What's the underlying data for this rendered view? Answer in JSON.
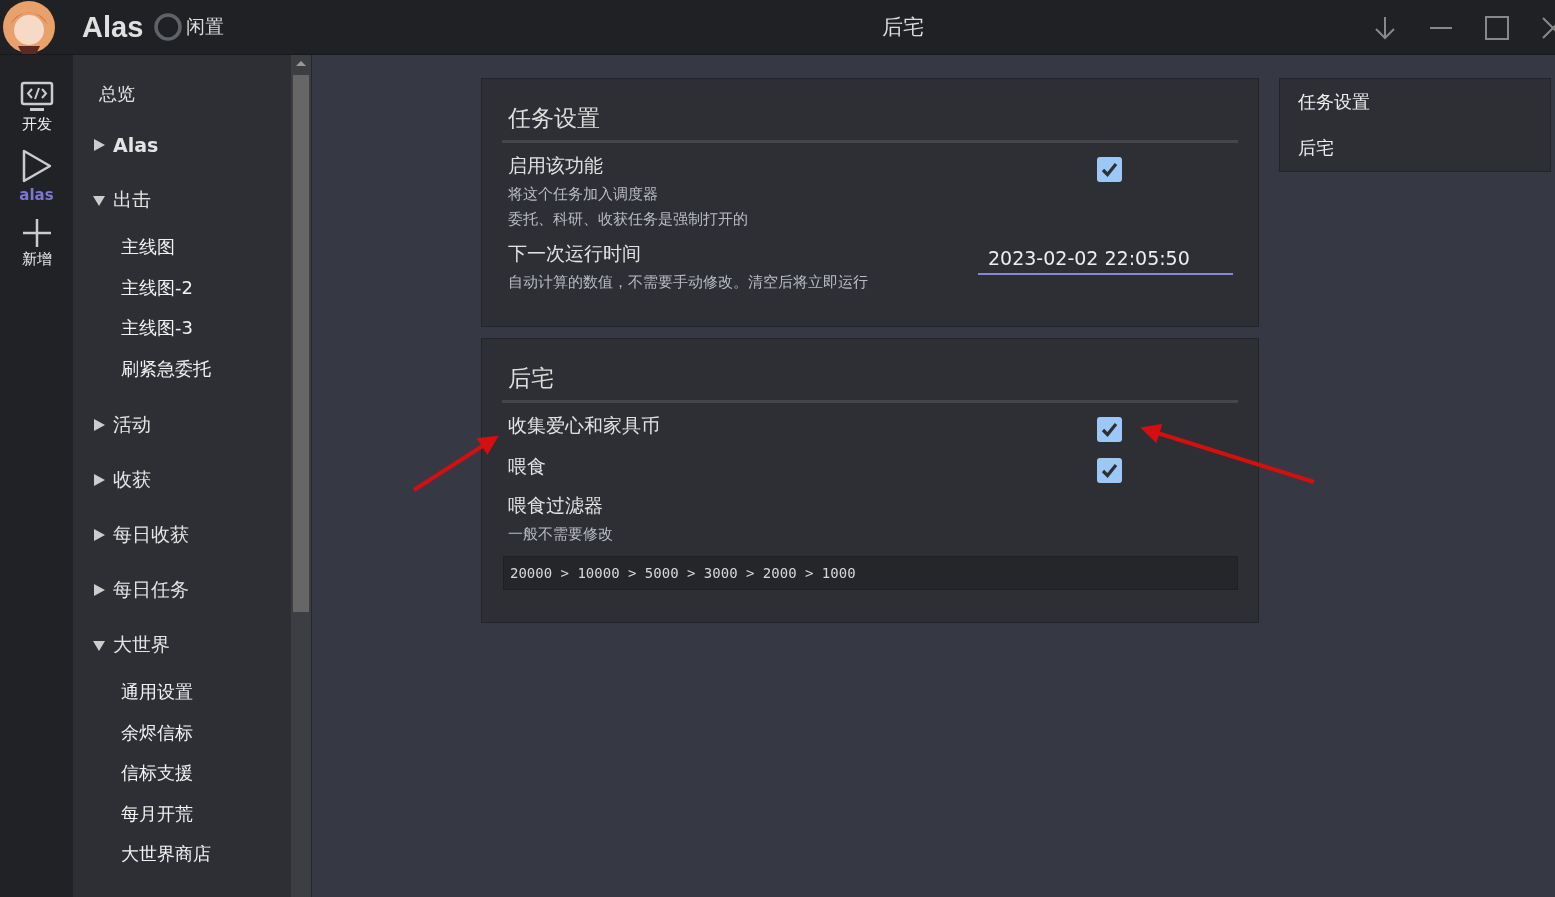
{
  "header": {
    "app_name": "Alas",
    "status": "闲置",
    "page_title": "后宅"
  },
  "rail": [
    {
      "kind": "code",
      "label": "开发",
      "selected": false
    },
    {
      "kind": "play",
      "label": "alas",
      "selected": true
    },
    {
      "kind": "add",
      "label": "新增",
      "selected": false
    }
  ],
  "nav": [
    {
      "kind": "item",
      "label": "总览"
    },
    {
      "kind": "group",
      "label": "Alas",
      "bold": true,
      "expanded": false
    },
    {
      "kind": "group",
      "label": "出击",
      "expanded": true,
      "children": [
        {
          "label": "主线图"
        },
        {
          "label": "主线图-2"
        },
        {
          "label": "主线图-3"
        },
        {
          "label": "刷紧急委托"
        }
      ]
    },
    {
      "kind": "group",
      "label": "活动",
      "expanded": false
    },
    {
      "kind": "group",
      "label": "收获",
      "expanded": false
    },
    {
      "kind": "group",
      "label": "每日收获",
      "expanded": false
    },
    {
      "kind": "group",
      "label": "每日任务",
      "expanded": false
    },
    {
      "kind": "group",
      "label": "大世界",
      "expanded": true,
      "children": [
        {
          "label": "通用设置"
        },
        {
          "label": "余烬信标"
        },
        {
          "label": "信标支援"
        },
        {
          "label": "每月开荒"
        },
        {
          "label": "大世界商店"
        }
      ]
    }
  ],
  "cards": [
    {
      "title": "任务设置",
      "rows": [
        {
          "kind": "checkbox",
          "label": "启用该功能",
          "help": [
            "将这个任务加入调度器",
            "委托、科研、收获任务是强制打开的"
          ],
          "checked": true
        },
        {
          "kind": "input",
          "label": "下一次运行时间",
          "help": [
            "自动计算的数值，不需要手动修改。清空后将立即运行"
          ],
          "value": "2023-02-02 22:05:50"
        }
      ]
    },
    {
      "title": "后宅",
      "rows": [
        {
          "kind": "checkbox",
          "label": "收集爱心和家具币",
          "checked": true
        },
        {
          "kind": "checkbox",
          "label": "喂食",
          "checked": true
        },
        {
          "kind": "textarea",
          "label": "喂食过滤器",
          "help": [
            "一般不需要修改"
          ],
          "value": "20000 > 10000 > 5000 > 3000 > 2000 > 1000"
        }
      ]
    }
  ],
  "toc": [
    {
      "label": "任务设置"
    },
    {
      "label": "后宅"
    }
  ],
  "annotations": [
    {
      "kind": "arrow-up-right"
    },
    {
      "kind": "arrow-left"
    }
  ]
}
